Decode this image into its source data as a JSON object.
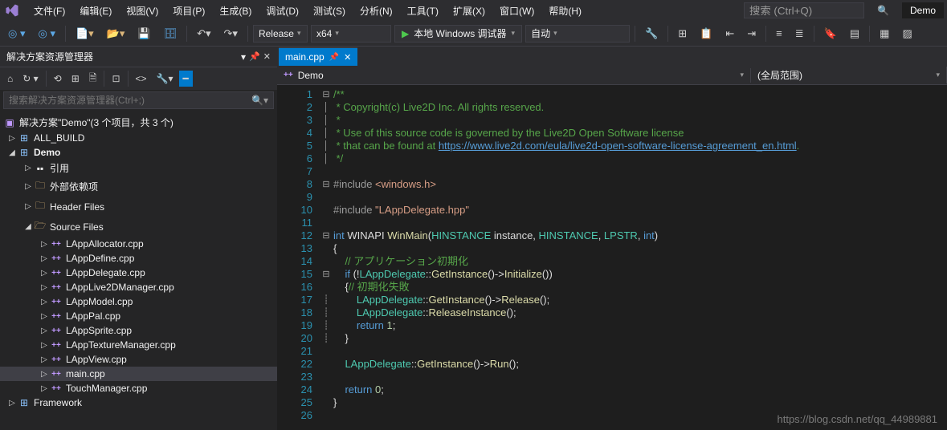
{
  "menu": {
    "items": [
      "文件(F)",
      "编辑(E)",
      "视图(V)",
      "项目(P)",
      "生成(B)",
      "调试(D)",
      "测试(S)",
      "分析(N)",
      "工具(T)",
      "扩展(X)",
      "窗口(W)",
      "帮助(H)"
    ],
    "search_placeholder": "搜索 (Ctrl+Q)",
    "title_right": "Demo"
  },
  "toolbar": {
    "config": "Release",
    "platform": "x64",
    "debug_target": "本地 Windows 调试器",
    "auto": "自动"
  },
  "sidebar": {
    "title": "解决方案资源管理器",
    "search_placeholder": "搜索解决方案资源管理器(Ctrl+;)",
    "solution": "解决方案\"Demo\"(3 个项目，共 3 个)",
    "nodes": {
      "all_build": "ALL_BUILD",
      "demo": "Demo",
      "refs": "引用",
      "ext_deps": "外部依赖项",
      "headers": "Header Files",
      "sources": "Source Files",
      "files": [
        "LAppAllocator.cpp",
        "LAppDefine.cpp",
        "LAppDelegate.cpp",
        "LAppLive2DManager.cpp",
        "LAppModel.cpp",
        "LAppPal.cpp",
        "LAppSprite.cpp",
        "LAppTextureManager.cpp",
        "LAppView.cpp",
        "main.cpp",
        "TouchManager.cpp"
      ],
      "framework": "Framework"
    }
  },
  "editor": {
    "tab": "main.cpp",
    "nav_left": "Demo",
    "nav_right": "(全局范围)",
    "code": {
      "l1": "/**",
      "l2": " * Copyright(c) Live2D Inc. All rights reserved.",
      "l3": " *",
      "l4": " * Use of this source code is governed by the Live2D Open Software license",
      "l5a": " * that can be found at ",
      "l5b": "https://www.live2d.com/eula/live2d-open-software-license-agreement_en.html",
      "l5c": ".",
      "l6": " */",
      "l8a": "#include ",
      "l8b": "<windows.h>",
      "l10a": "#include ",
      "l10b": "\"LAppDelegate.hpp\"",
      "l12a": "int",
      "l12b": " WINAPI ",
      "l12c": "WinMain",
      "l12d": "(",
      "l12e": "HINSTANCE",
      "l12f": " instance, ",
      "l12g": "HINSTANCE",
      "l12h": ", ",
      "l12i": "LPSTR",
      "l12j": ", ",
      "l12k": "int",
      "l12l": ")",
      "l13": "{",
      "l14": "    // アプリケーション初期化",
      "l15a": "    if",
      "l15b": " (!",
      "l15c": "LAppDelegate",
      "l15d": "::",
      "l15e": "GetInstance",
      "l15f": "()->",
      "l15g": "Initialize",
      "l15h": "())",
      "l16a": "    {",
      "l16b": "// 初期化失敗",
      "l17a": "        LAppDelegate",
      "l17b": "::",
      "l17c": "GetInstance",
      "l17d": "()->",
      "l17e": "Release",
      "l17f": "();",
      "l18a": "        LAppDelegate",
      "l18b": "::",
      "l18c": "ReleaseInstance",
      "l18d": "();",
      "l19a": "        return",
      "l19b": " 1",
      "l19c": ";",
      "l20": "    }",
      "l22a": "    LAppDelegate",
      "l22b": "::",
      "l22c": "GetInstance",
      "l22d": "()->",
      "l22e": "Run",
      "l22f": "();",
      "l24a": "    return",
      "l24b": " 0",
      "l24c": ";",
      "l25": "}"
    }
  },
  "watermark": "https://blog.csdn.net/qq_44989881"
}
